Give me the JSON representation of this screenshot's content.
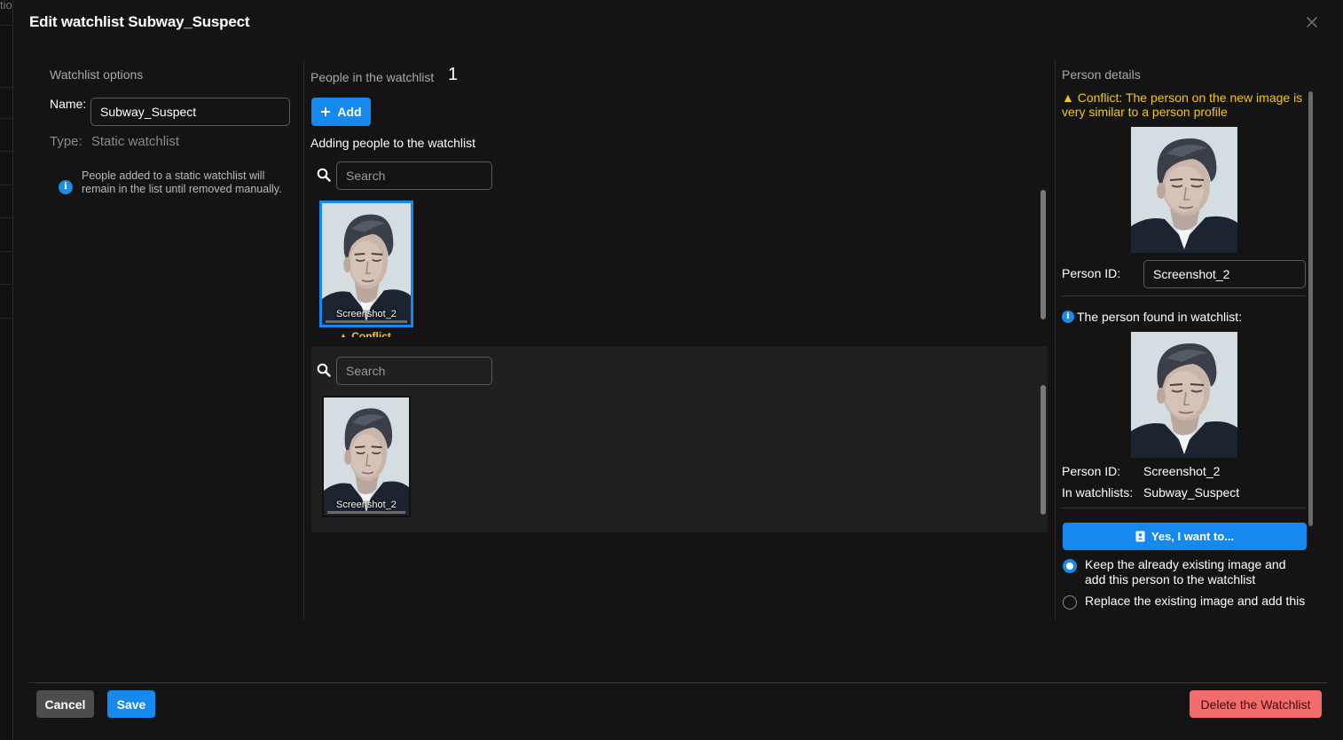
{
  "backdrop": {
    "text": "tio"
  },
  "modal": {
    "title": "Edit watchlist Subway_Suspect"
  },
  "options": {
    "section_title": "Watchlist options",
    "name_label": "Name:",
    "name_value": "Subway_Suspect",
    "type_label": "Type:",
    "type_value": "Static watchlist",
    "info_text": "People added to a static watchlist will remain in the list until removed manually."
  },
  "people": {
    "section_title": "People in the watchlist",
    "count": "1",
    "add_label": "Add",
    "adding_heading": "Adding people to the watchlist",
    "search_placeholder": "Search",
    "new_card": {
      "caption": "Screenshot_2",
      "tag": "Conflict"
    },
    "existing_card": {
      "caption": "Screenshot_2"
    }
  },
  "details": {
    "section_title": "Person details",
    "conflict_text": "Conflict: The person on the new image is very similar to a person profile",
    "person_id_label": "Person ID:",
    "person_id_value": "Screenshot_2",
    "found_text": "The person found in watchlist:",
    "found_person_id_label": "Person ID:",
    "found_person_id_value": "Screenshot_2",
    "in_watchlists_label": "In watchlists:",
    "in_watchlists_value": "Subway_Suspect",
    "yes_button": "Yes, I want to...",
    "option_keep": "Keep the already existing image and add this person to the watchlist",
    "option_replace": "Replace the existing image and add this"
  },
  "footer": {
    "cancel": "Cancel",
    "save": "Save",
    "delete": "Delete the Watchlist"
  },
  "colors": {
    "accent": "#1589ee",
    "warning": "#f5c518",
    "danger": "#f36b6b",
    "background": "#141414"
  }
}
